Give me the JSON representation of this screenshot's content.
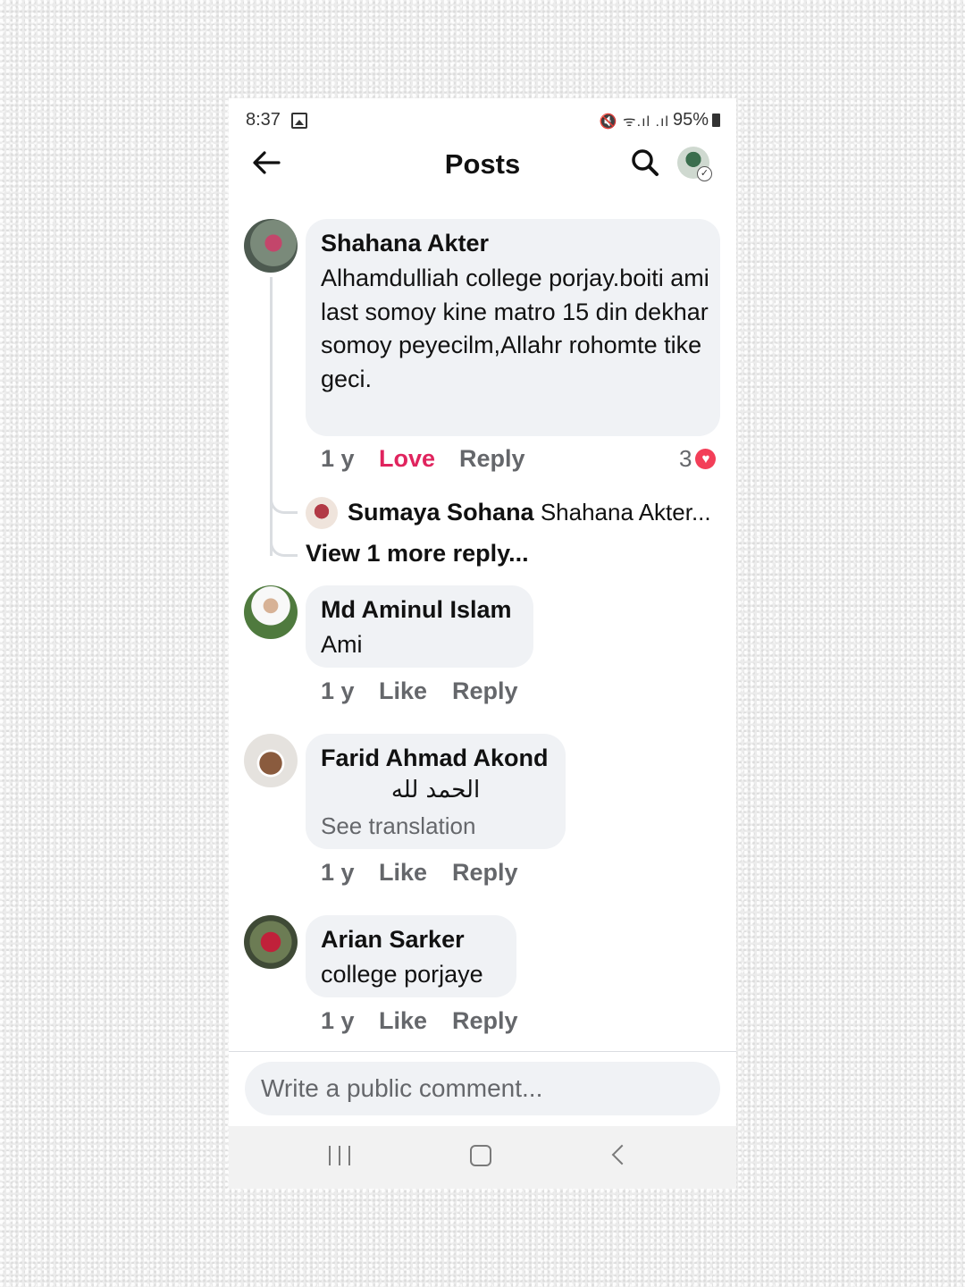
{
  "status_bar": {
    "time": "8:37",
    "signal_text": "🔇 ᯤ.ıl .ıl",
    "battery": "95%"
  },
  "header": {
    "title": "Posts"
  },
  "comments": [
    {
      "author": "Shahana Akter",
      "text": "Alhamdulliah college porjay.boiti ami last somoy kine matro 15 din dekhar somoy peyecilm,Allahr rohomte tike geci.",
      "time": "1 y",
      "like_label": "Love",
      "reply_label": "Reply",
      "reaction_count": "3",
      "reply_preview": {
        "author": "Sumaya Sohana",
        "text": "Shahana Akter..."
      },
      "more_replies": "View 1 more reply..."
    },
    {
      "author": "Md Aminul Islam",
      "text": "Ami",
      "time": "1 y",
      "like_label": "Like",
      "reply_label": "Reply"
    },
    {
      "author": "Farid Ahmad Akond",
      "text": "الحمد لله",
      "see_translation": "See translation",
      "time": "1 y",
      "like_label": "Like",
      "reply_label": "Reply"
    },
    {
      "author": "Arian Sarker",
      "text": "college porjaye",
      "time": "1 y",
      "like_label": "Like",
      "reply_label": "Reply"
    }
  ],
  "composer": {
    "placeholder": "Write a public comment..."
  },
  "colors": {
    "love": "#e0245e",
    "bubble": "#f0f2f5",
    "meta": "#65676b",
    "heart": "#f33e58"
  },
  "icons": [
    "gallery-icon",
    "mute-icon",
    "wifi-icon",
    "signal-icon",
    "battery-icon",
    "back-arrow-icon",
    "search-icon",
    "heart-icon",
    "recent-apps-icon",
    "home-icon",
    "nav-back-icon"
  ]
}
